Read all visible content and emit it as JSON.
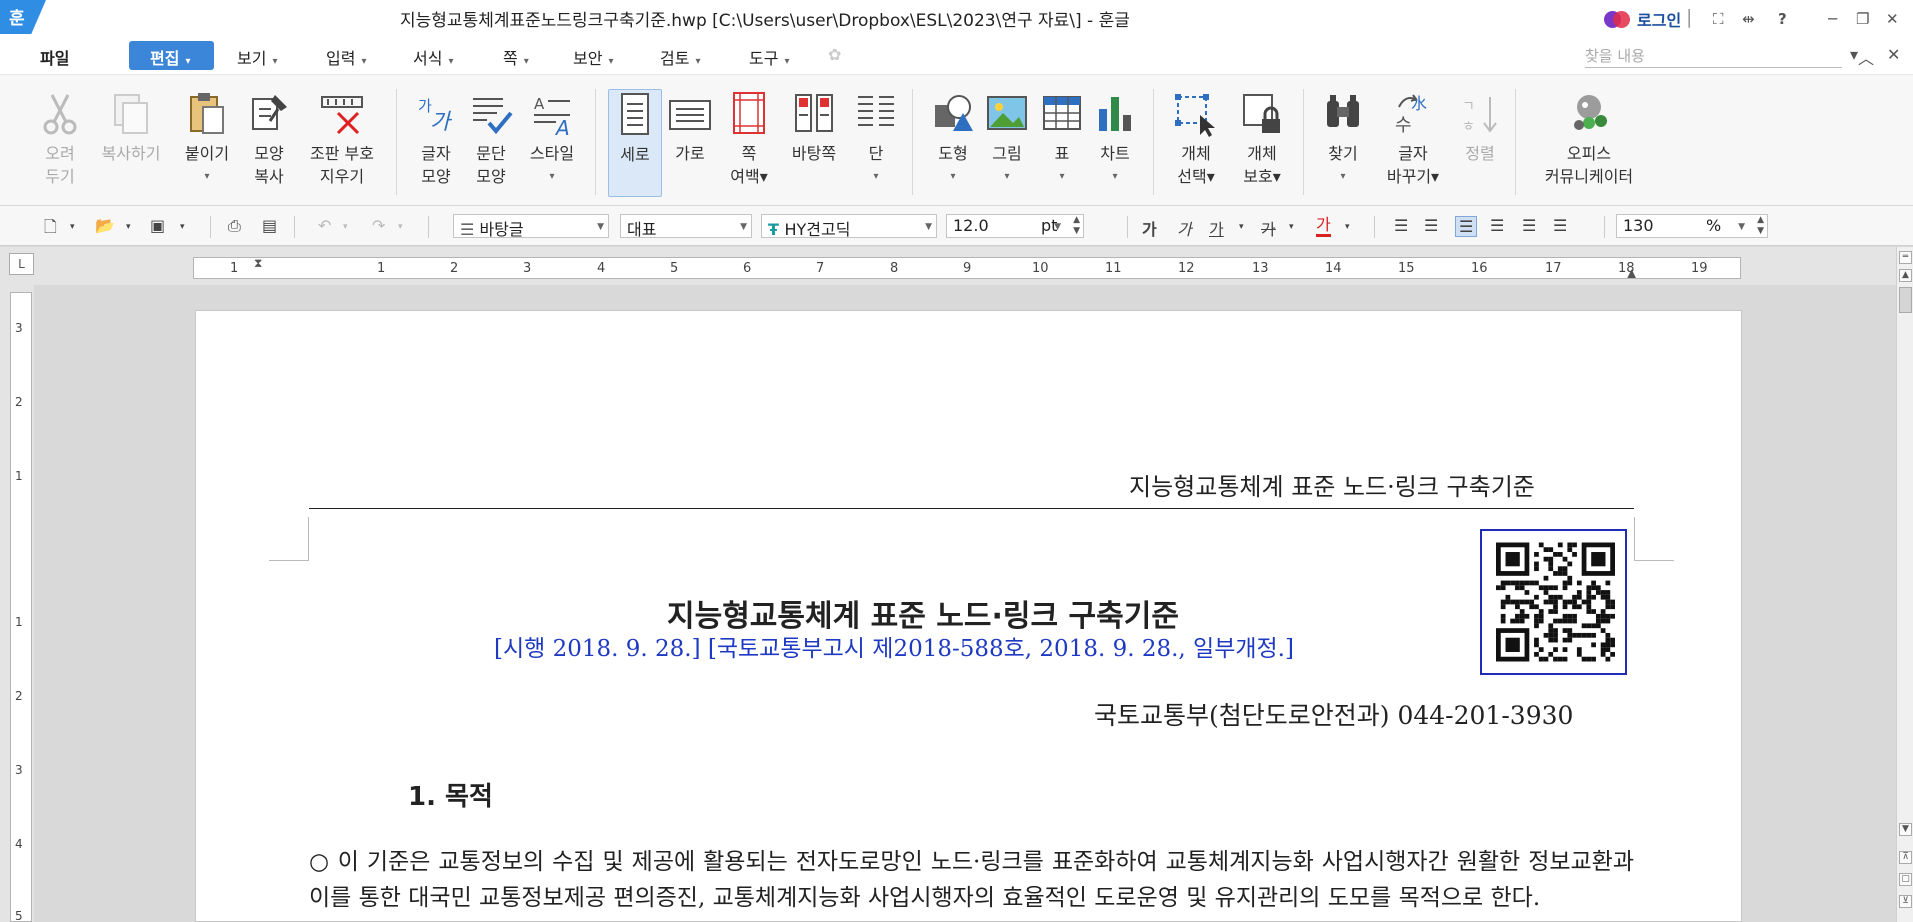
{
  "window": {
    "app_logo": "훈",
    "title": "지능형교통체계표준노드링크구축기준.hwp [C:\\Users\\user\\Dropbox\\ESL\\2023\\연구 자료\\] - 훈글",
    "login_label": "로그인",
    "controls": {
      "fullscreen": "⛶",
      "split": "⇹",
      "help": "?",
      "minimize": "─",
      "restore": "❐",
      "close": "✕"
    }
  },
  "menubar": {
    "items": [
      {
        "label": "파일",
        "dropdown": false
      },
      {
        "label": "편집",
        "dropdown": true,
        "selected": true
      },
      {
        "label": "보기",
        "dropdown": true
      },
      {
        "label": "입력",
        "dropdown": true
      },
      {
        "label": "서식",
        "dropdown": true
      },
      {
        "label": "쪽",
        "dropdown": true
      },
      {
        "label": "보안",
        "dropdown": true
      },
      {
        "label": "검토",
        "dropdown": true
      },
      {
        "label": "도구",
        "dropdown": true
      }
    ],
    "search_placeholder": "찾을 내용",
    "collapse_ribbon": "︿",
    "close_doc": "✕"
  },
  "ribbon": {
    "buttons": [
      {
        "line1": "오려",
        "line2": "두기",
        "icon": "scissors-icon",
        "disabled": true
      },
      {
        "line1": "복사하기",
        "line2": "",
        "icon": "copy-icon",
        "disabled": true
      },
      {
        "line1": "붙이기",
        "line2": "▾",
        "icon": "paste-icon"
      },
      {
        "line1": "모양",
        "line2": "복사",
        "icon": "format-painter-icon"
      },
      {
        "line1": "조판 부호",
        "line2": "지우기",
        "icon": "clear-markup-icon"
      },
      {
        "line1": "글자",
        "line2": "모양",
        "icon": "char-shape-icon"
      },
      {
        "line1": "문단",
        "line2": "모양",
        "icon": "para-shape-icon"
      },
      {
        "line1": "스타일",
        "line2": "▾",
        "icon": "style-icon"
      },
      {
        "line1": "세로",
        "line2": "",
        "icon": "portrait-icon",
        "active": true
      },
      {
        "line1": "가로",
        "line2": "",
        "icon": "landscape-icon"
      },
      {
        "line1": "쪽",
        "line2": "여백▾",
        "icon": "margin-icon"
      },
      {
        "line1": "바탕쪽",
        "line2": "",
        "icon": "master-page-icon"
      },
      {
        "line1": "단",
        "line2": "▾",
        "icon": "columns-icon"
      },
      {
        "line1": "도형",
        "line2": "▾",
        "icon": "shape-icon"
      },
      {
        "line1": "그림",
        "line2": "▾",
        "icon": "picture-icon"
      },
      {
        "line1": "표",
        "line2": "▾",
        "icon": "table-icon"
      },
      {
        "line1": "차트",
        "line2": "▾",
        "icon": "chart-icon"
      },
      {
        "line1": "개체",
        "line2": "선택▾",
        "icon": "select-object-icon"
      },
      {
        "line1": "개체",
        "line2": "보호▾",
        "icon": "lock-object-icon"
      },
      {
        "line1": "찾기",
        "line2": "▾",
        "icon": "binoculars-icon"
      },
      {
        "line1": "글자",
        "line2": "바꾸기▾",
        "icon": "char-convert-icon"
      },
      {
        "line1": "정렬",
        "line2": "",
        "icon": "sort-icon",
        "disabled": true
      },
      {
        "line1": "오피스",
        "line2": "커뮤니케이터",
        "icon": "communicator-icon"
      }
    ]
  },
  "toolbar": {
    "style_value": "바탕글",
    "lang_value": "대표",
    "font_value": "HY견고딕",
    "size_value": "12.0",
    "size_unit": "pt",
    "zoom_value": "130",
    "zoom_unit": "%",
    "bold": "가",
    "italic": "가",
    "underline": "가",
    "strike": "가",
    "color": "가"
  },
  "ruler": {
    "corner": "L",
    "h_ticks": [
      "1",
      "1",
      "2",
      "3",
      "4",
      "5",
      "6",
      "7",
      "8",
      "9",
      "10",
      "11",
      "12",
      "13",
      "14",
      "15",
      "16",
      "17",
      "18",
      "19"
    ],
    "v_ticks": [
      "3",
      "2",
      "1",
      "1",
      "2",
      "3",
      "4",
      "5"
    ]
  },
  "document": {
    "running_header": "지능형교통체계 표준 노드·링크 구축기준",
    "title": "지능형교통체계 표준 노드·링크 구축기준",
    "subtitle": "[시행 2018. 9. 28.] [국토교통부고시 제2018-588호, 2018. 9. 28., 일부개정.]",
    "ministry": "국토교통부(첨단도로안전과) 044-201-3930",
    "section1": "1. 목적",
    "paragraph": "○ 이 기준은 교통정보의 수집 및 제공에 활용되는 전자도로망인 노드·링크를 표준화하여 교통체계지능화 사업시행자간 원활한 정보교환과 이를 통한 대국민 교통정보제공 편의증진, 교통체계지능화 사업시행자의 효율적인 도로운영 및 유지관리의 도모를 목적으로 한다."
  },
  "colors": {
    "accent": "#3b86d9",
    "link_blue": "#1f3ac2",
    "qr_border": "#1d2bb8"
  }
}
